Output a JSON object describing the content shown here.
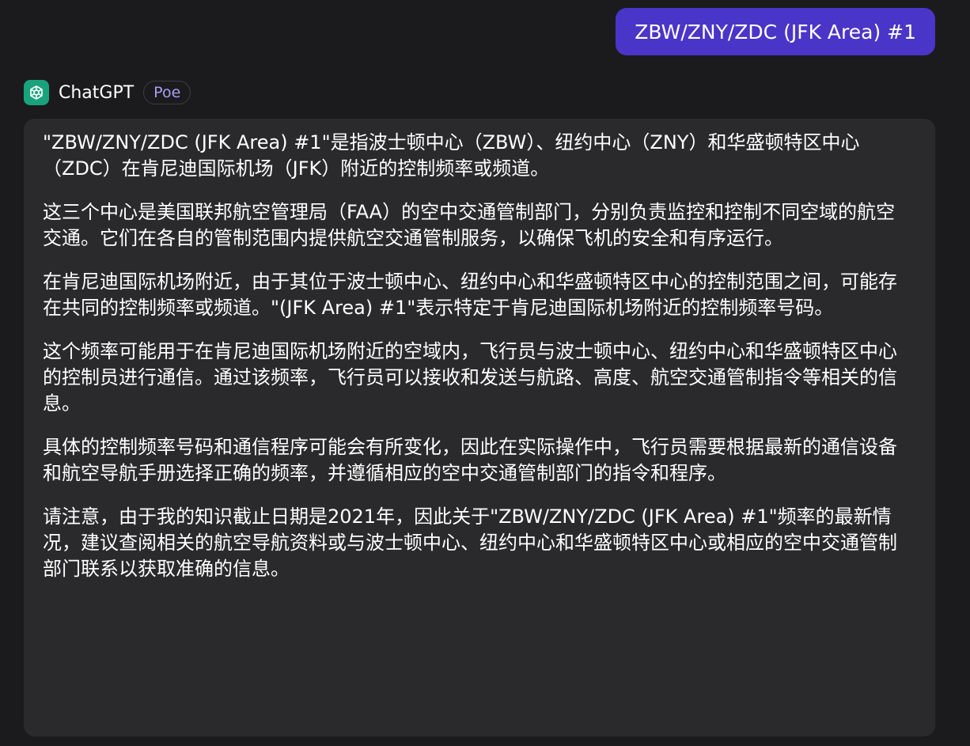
{
  "user_message": {
    "text": "ZBW/ZNY/ZDC (JFK Area) #1"
  },
  "bot": {
    "name": "ChatGPT",
    "badge": "Poe",
    "avatar_icon": "openai-logo-icon",
    "avatar_color": "#19a37d"
  },
  "response": {
    "paragraphs": [
      "\"ZBW/ZNY/ZDC (JFK Area) #1\"是指波士顿中心（ZBW）、纽约中心（ZNY）和华盛顿特区中心（ZDC）在肯尼迪国际机场（JFK）附近的控制频率或频道。",
      "这三个中心是美国联邦航空管理局（FAA）的空中交通管制部门，分别负责监控和控制不同空域的航空交通。它们在各自的管制范围内提供航空交通管制服务，以确保飞机的安全和有序运行。",
      "在肯尼迪国际机场附近，由于其位于波士顿中心、纽约中心和华盛顿特区中心的控制范围之间，可能存在共同的控制频率或频道。\"(JFK Area) #1\"表示特定于肯尼迪国际机场附近的控制频率号码。",
      "这个频率可能用于在肯尼迪国际机场附近的空域内，飞行员与波士顿中心、纽约中心和华盛顿特区中心的控制员进行通信。通过该频率，飞行员可以接收和发送与航路、高度、航空交通管制指令等相关的信息。",
      "具体的控制频率号码和通信程序可能会有所变化，因此在实际操作中，飞行员需要根据最新的通信设备和航空导航手册选择正确的频率，并遵循相应的空中交通管制部门的指令和程序。",
      "请注意，由于我的知识截止日期是2021年，因此关于\"ZBW/ZNY/ZDC (JFK Area) #1\"频率的最新情况，建议查阅相关的航空导航资料或与波士顿中心、纽约中心和华盛顿特区中心或相应的空中交通管制部门联系以获取准确的信息。"
    ]
  },
  "colors": {
    "background": "#1b1b1d",
    "user_bubble": "#4a35c9",
    "bot_bubble": "#2a2a2c",
    "badge_text": "#a99df5"
  }
}
